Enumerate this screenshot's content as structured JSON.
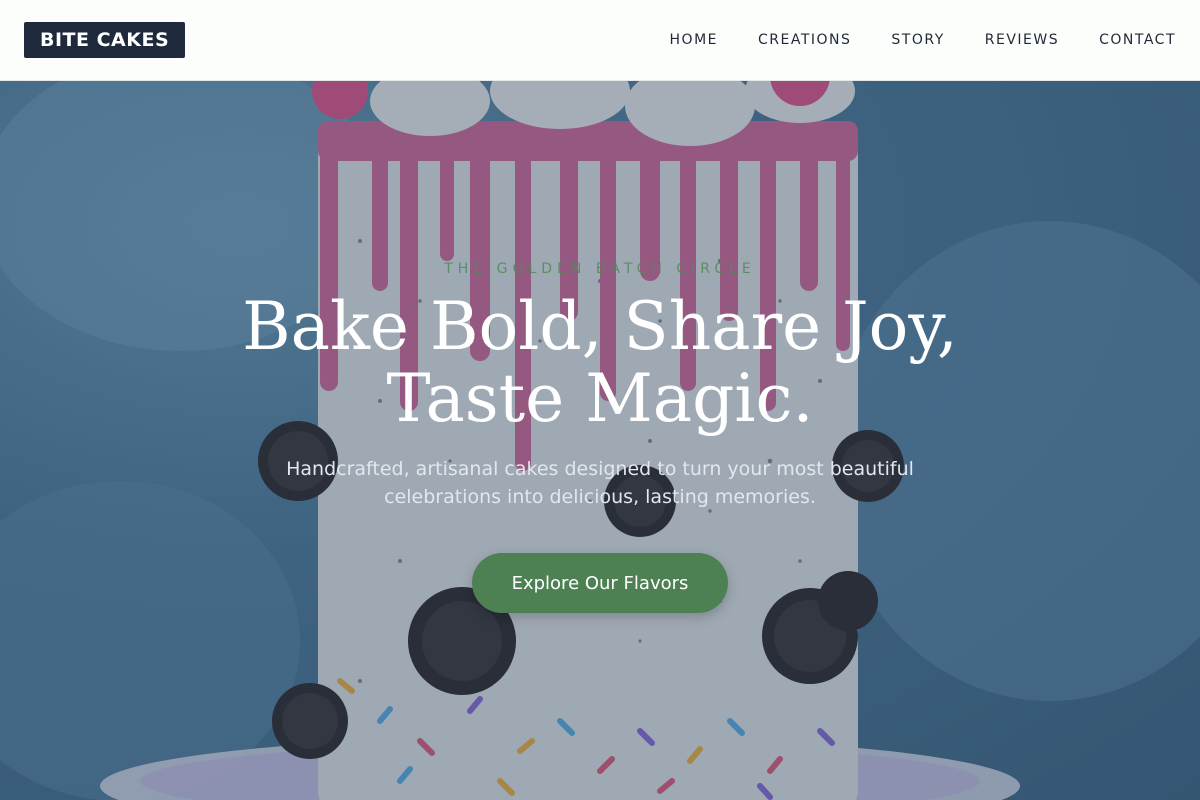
{
  "brand": {
    "logo_text": "BITE CAKES"
  },
  "nav": {
    "items": [
      {
        "label": "HOME"
      },
      {
        "label": "CREATIONS"
      },
      {
        "label": "STORY"
      },
      {
        "label": "REVIEWS"
      },
      {
        "label": "CONTACT"
      }
    ]
  },
  "hero": {
    "eyebrow": "THE GOLDEN BATCH CIRCLE",
    "headline_line1": "Bake Bold, Share Joy,",
    "headline_line2": "Taste Magic.",
    "subtext_line1": "Handcrafted, artisanal cakes designed to turn your most beautiful",
    "subtext_line2": "celebrations into delicious, lasting memories.",
    "cta_label": "Explore Our Flavors"
  },
  "colors": {
    "brand_dark": "#1e2a3c",
    "accent_green": "#4d8154",
    "header_bg": "#fcfefc"
  },
  "background_image": {
    "subject": "drip-cake-with-cookies-and-sprinkles"
  }
}
